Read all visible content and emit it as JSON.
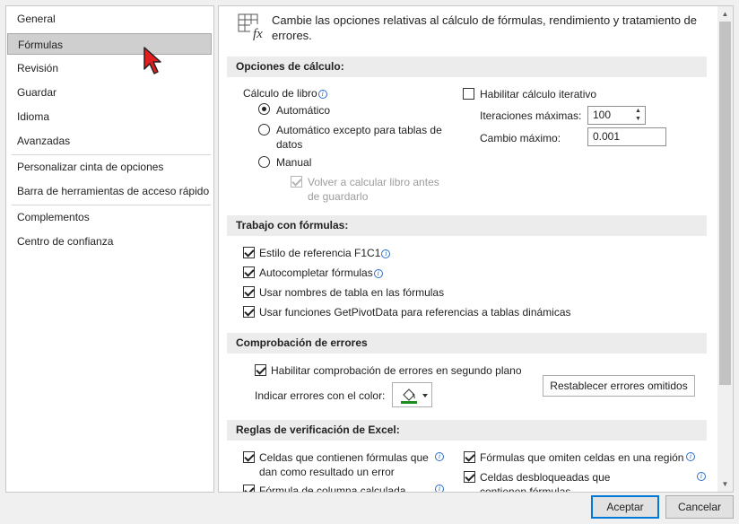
{
  "nav": {
    "items": [
      {
        "label": "General"
      },
      {
        "label": "Fórmulas",
        "selected": true
      },
      {
        "label": "Revisión"
      },
      {
        "label": "Guardar"
      },
      {
        "label": "Idioma"
      },
      {
        "label": "Avanzadas"
      },
      {
        "label": "Personalizar cinta de opciones"
      },
      {
        "label": "Barra de herramientas de acceso rápido"
      },
      {
        "label": "Complementos"
      },
      {
        "label": "Centro de confianza"
      }
    ]
  },
  "header": {
    "icon": "formula-fx-icon",
    "text": "Cambie las opciones relativas al cálculo de fórmulas, rendimiento y tratamiento de errores."
  },
  "calc": {
    "title": "Opciones de cálculo:",
    "workbook_label": "Cálculo de libro",
    "automatic": "Automático",
    "automatic_except": "Automático excepto para tablas de datos",
    "manual": "Manual",
    "recalc_before_save": "Volver a calcular libro antes de guardarlo",
    "iterative": "Habilitar cálculo iterativo",
    "max_iterations_label": "Iteraciones máximas:",
    "max_iterations_value": "100",
    "max_change_label": "Cambio máximo:",
    "max_change_value": "0.001"
  },
  "formulas": {
    "title": "Trabajo con fórmulas:",
    "r1c1": "Estilo de referencia F1C1",
    "autocomplete": "Autocompletar fórmulas",
    "table_names": "Usar nombres de tabla en las fórmulas",
    "getpivotdata": "Usar funciones GetPivotData para referencias a tablas dinámicas"
  },
  "errors": {
    "title": "Comprobación de errores",
    "background_check": "Habilitar comprobación de errores en segundo plano",
    "color_label": "Indicar errores con el color:",
    "reset_button": "Restablecer errores omitidos",
    "indicator_color": "#1e8c1e"
  },
  "rules": {
    "title": "Reglas de verificación de Excel:",
    "cells_error": "Celdas que contienen fórmulas que dan como resultado un error",
    "column_formula": "Fórmula de columna calculada",
    "omit_cells": "Fórmulas que omiten celdas en una región",
    "unlocked_cells": "Celdas desbloqueadas que contienen fórmulas"
  },
  "footer": {
    "ok": "Aceptar",
    "cancel": "Cancelar"
  }
}
